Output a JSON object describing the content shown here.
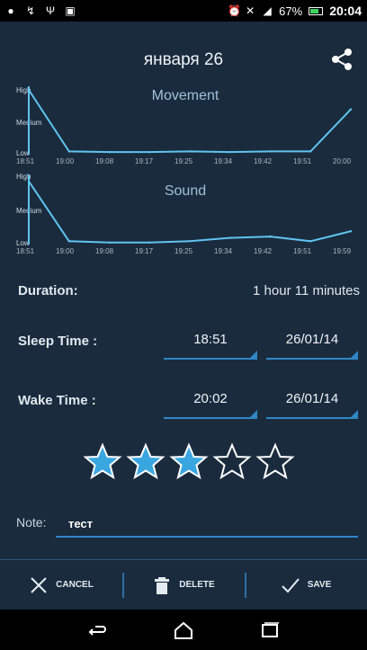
{
  "status_bar": {
    "battery": "67%",
    "time": "20:04",
    "left_icons": [
      "chat-icon",
      "missed-call-icon",
      "usb-icon",
      "image-icon"
    ],
    "right_icons": [
      "alarm-icon",
      "mute-icon",
      "signal-icon",
      "battery-icon"
    ]
  },
  "header": {
    "title": "января 26",
    "share_icon": "share-icon"
  },
  "charts": {
    "movement": {
      "title": "Movement",
      "levels": [
        "High",
        "Medium",
        "Low"
      ],
      "ticks": [
        "18:51",
        "19:00",
        "19:08",
        "19:17",
        "19:25",
        "19:34",
        "19:42",
        "19:51",
        "20:00"
      ]
    },
    "sound": {
      "title": "Sound",
      "levels": [
        "High",
        "Medium",
        "Low"
      ],
      "ticks": [
        "18:51",
        "19:00",
        "19:08",
        "19:17",
        "19:25",
        "19:34",
        "19:42",
        "19:51",
        "19:59"
      ]
    }
  },
  "chart_data": [
    {
      "type": "line",
      "title": "Movement",
      "x": [
        "18:51",
        "19:00",
        "19:08",
        "19:17",
        "19:25",
        "19:34",
        "19:42",
        "19:51",
        "20:00"
      ],
      "y_levels": [
        "Low",
        "Medium",
        "High"
      ],
      "series": [
        {
          "values": [
            1.0,
            0.05,
            0.04,
            0.04,
            0.05,
            0.04,
            0.05,
            0.05,
            0.7
          ]
        }
      ],
      "grid": false
    },
    {
      "type": "line",
      "title": "Sound",
      "x": [
        "18:51",
        "19:00",
        "19:08",
        "19:17",
        "19:25",
        "19:34",
        "19:42",
        "19:51",
        "19:59"
      ],
      "y_levels": [
        "Low",
        "Medium",
        "High"
      ],
      "series": [
        {
          "values": [
            0.95,
            0.05,
            0.03,
            0.03,
            0.05,
            0.1,
            0.12,
            0.05,
            0.2
          ]
        }
      ],
      "grid": false
    }
  ],
  "details": {
    "duration_label": "Duration:",
    "duration_value": "1 hour 11 minutes",
    "sleep_label": "Sleep Time :",
    "sleep_time": "18:51",
    "sleep_date": "26/01/14",
    "wake_label": "Wake Time :",
    "wake_time": "20:02",
    "wake_date": "26/01/14"
  },
  "rating": {
    "value": 3,
    "max": 5
  },
  "note": {
    "label": "Note:",
    "value": "тест"
  },
  "actions": {
    "cancel": "CANCEL",
    "delete": "DELETE",
    "save": "SAVE"
  },
  "colors": {
    "accent": "#2f86c5",
    "star_filled": "#3aa6e0",
    "background": "#1a2b3d",
    "chart_line": "#5fc4f0"
  }
}
